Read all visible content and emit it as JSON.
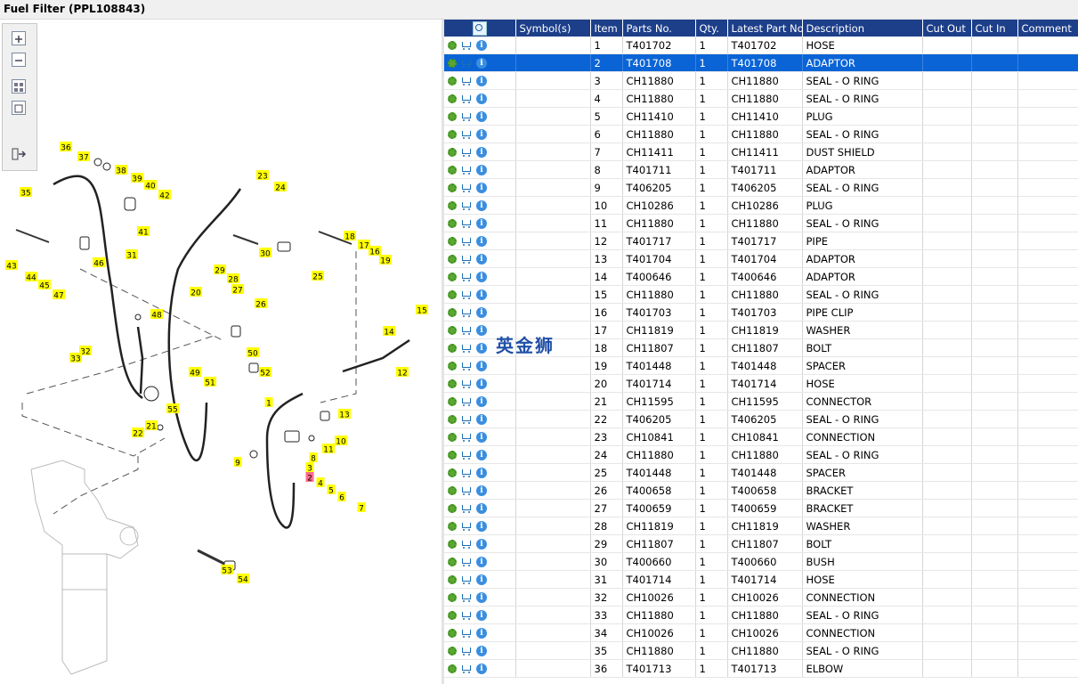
{
  "window": {
    "title": "Fuel Filter (PPL108843)"
  },
  "watermark": "英金狮",
  "colors": {
    "header_bg": "#1d3f8a",
    "selected_row": "#0a64d6",
    "callout": "#ffff00",
    "callout_selected": "#ff6b8a"
  },
  "diagram": {
    "selected_callout": "2",
    "callouts": [
      "1",
      "2",
      "3",
      "4",
      "5",
      "6",
      "7",
      "8",
      "9",
      "10",
      "11",
      "12",
      "13",
      "14",
      "15",
      "16",
      "17",
      "18",
      "19",
      "20",
      "21",
      "22",
      "23",
      "24",
      "25",
      "26",
      "27",
      "28",
      "29",
      "30",
      "31",
      "32",
      "33",
      "35",
      "36",
      "37",
      "38",
      "39",
      "40",
      "41",
      "42",
      "43",
      "44",
      "45",
      "46",
      "47",
      "48",
      "49",
      "50",
      "51",
      "52",
      "53",
      "54",
      "55"
    ]
  },
  "toolbar": {
    "icons": [
      "zoom-in-icon",
      "zoom-out-icon",
      "fit-all-icon",
      "fit-window-icon",
      "export-icon"
    ]
  },
  "table": {
    "columns": [
      "",
      "Symbol(s)",
      "Item",
      "Parts No.",
      "Qty.",
      "Latest Part No.",
      "Description",
      "Cut Out",
      "Cut In",
      "Comment"
    ],
    "selected_index": 1,
    "rows": [
      {
        "item": "1",
        "part": "T401702",
        "qty": "1",
        "latest": "T401702",
        "desc": "HOSE"
      },
      {
        "item": "2",
        "part": "T401708",
        "qty": "1",
        "latest": "T401708",
        "desc": "ADAPTOR"
      },
      {
        "item": "3",
        "part": "CH11880",
        "qty": "1",
        "latest": "CH11880",
        "desc": "SEAL - O RING"
      },
      {
        "item": "4",
        "part": "CH11880",
        "qty": "1",
        "latest": "CH11880",
        "desc": "SEAL - O RING"
      },
      {
        "item": "5",
        "part": "CH11410",
        "qty": "1",
        "latest": "CH11410",
        "desc": "PLUG"
      },
      {
        "item": "6",
        "part": "CH11880",
        "qty": "1",
        "latest": "CH11880",
        "desc": "SEAL - O RING"
      },
      {
        "item": "7",
        "part": "CH11411",
        "qty": "1",
        "latest": "CH11411",
        "desc": "DUST SHIELD"
      },
      {
        "item": "8",
        "part": "T401711",
        "qty": "1",
        "latest": "T401711",
        "desc": "ADAPTOR"
      },
      {
        "item": "9",
        "part": "T406205",
        "qty": "1",
        "latest": "T406205",
        "desc": "SEAL - O RING"
      },
      {
        "item": "10",
        "part": "CH10286",
        "qty": "1",
        "latest": "CH10286",
        "desc": "PLUG"
      },
      {
        "item": "11",
        "part": "CH11880",
        "qty": "1",
        "latest": "CH11880",
        "desc": "SEAL - O RING"
      },
      {
        "item": "12",
        "part": "T401717",
        "qty": "1",
        "latest": "T401717",
        "desc": "PIPE"
      },
      {
        "item": "13",
        "part": "T401704",
        "qty": "1",
        "latest": "T401704",
        "desc": "ADAPTOR"
      },
      {
        "item": "14",
        "part": "T400646",
        "qty": "1",
        "latest": "T400646",
        "desc": "ADAPTOR"
      },
      {
        "item": "15",
        "part": "CH11880",
        "qty": "1",
        "latest": "CH11880",
        "desc": "SEAL - O RING"
      },
      {
        "item": "16",
        "part": "T401703",
        "qty": "1",
        "latest": "T401703",
        "desc": "PIPE CLIP"
      },
      {
        "item": "17",
        "part": "CH11819",
        "qty": "1",
        "latest": "CH11819",
        "desc": "WASHER"
      },
      {
        "item": "18",
        "part": "CH11807",
        "qty": "1",
        "latest": "CH11807",
        "desc": "BOLT"
      },
      {
        "item": "19",
        "part": "T401448",
        "qty": "1",
        "latest": "T401448",
        "desc": "SPACER"
      },
      {
        "item": "20",
        "part": "T401714",
        "qty": "1",
        "latest": "T401714",
        "desc": "HOSE"
      },
      {
        "item": "21",
        "part": "CH11595",
        "qty": "1",
        "latest": "CH11595",
        "desc": "CONNECTOR"
      },
      {
        "item": "22",
        "part": "T406205",
        "qty": "1",
        "latest": "T406205",
        "desc": "SEAL - O RING"
      },
      {
        "item": "23",
        "part": "CH10841",
        "qty": "1",
        "latest": "CH10841",
        "desc": "CONNECTION"
      },
      {
        "item": "24",
        "part": "CH11880",
        "qty": "1",
        "latest": "CH11880",
        "desc": "SEAL - O RING"
      },
      {
        "item": "25",
        "part": "T401448",
        "qty": "1",
        "latest": "T401448",
        "desc": "SPACER"
      },
      {
        "item": "26",
        "part": "T400658",
        "qty": "1",
        "latest": "T400658",
        "desc": "BRACKET"
      },
      {
        "item": "27",
        "part": "T400659",
        "qty": "1",
        "latest": "T400659",
        "desc": "BRACKET"
      },
      {
        "item": "28",
        "part": "CH11819",
        "qty": "1",
        "latest": "CH11819",
        "desc": "WASHER"
      },
      {
        "item": "29",
        "part": "CH11807",
        "qty": "1",
        "latest": "CH11807",
        "desc": "BOLT"
      },
      {
        "item": "30",
        "part": "T400660",
        "qty": "1",
        "latest": "T400660",
        "desc": "BUSH"
      },
      {
        "item": "31",
        "part": "T401714",
        "qty": "1",
        "latest": "T401714",
        "desc": "HOSE"
      },
      {
        "item": "32",
        "part": "CH10026",
        "qty": "1",
        "latest": "CH10026",
        "desc": "CONNECTION"
      },
      {
        "item": "33",
        "part": "CH11880",
        "qty": "1",
        "latest": "CH11880",
        "desc": "SEAL - O RING"
      },
      {
        "item": "34",
        "part": "CH10026",
        "qty": "1",
        "latest": "CH10026",
        "desc": "CONNECTION"
      },
      {
        "item": "35",
        "part": "CH11880",
        "qty": "1",
        "latest": "CH11880",
        "desc": "SEAL - O RING"
      },
      {
        "item": "36",
        "part": "T401713",
        "qty": "1",
        "latest": "T401713",
        "desc": "ELBOW"
      }
    ]
  }
}
